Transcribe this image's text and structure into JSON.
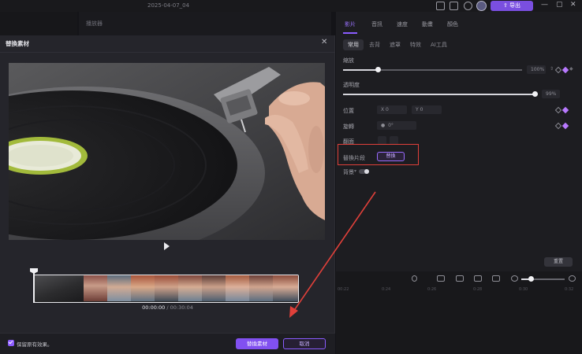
{
  "titlebar": {
    "date": "2025-04-07_04",
    "export_label": "导出"
  },
  "preview": {
    "header_label": "播放器"
  },
  "right_panel": {
    "tabs": [
      "影片",
      "音訊",
      "速度",
      "動畫",
      "顏色"
    ],
    "subtabs": [
      "常用",
      "去背",
      "遮罩",
      "特效",
      "AI工具"
    ],
    "scale_label": "縮放",
    "scale_value": "100%",
    "opacity_label": "透明度",
    "opacity_value": "99%",
    "position_label": "位置",
    "pos_x_label": "X",
    "pos_x_value": "0",
    "pos_y_label": "Y",
    "pos_y_value": "0",
    "rotate_label": "旋轉",
    "rotate_value": "0°",
    "flip_label": "翻面",
    "replace_clip_label": "替換片段",
    "replace_button": "替換",
    "background_label": "背景",
    "reset_button": "重置",
    "accent": "#8a5cff"
  },
  "timeline": {
    "ticks": [
      "00:22",
      "0:24",
      "0:26",
      "0:28",
      "0:30",
      "0:32"
    ]
  },
  "modal": {
    "title": "替換素材",
    "close_icon": "close-icon",
    "current_time": "00:00:00",
    "separator": " / ",
    "total_time": "00:30:04",
    "keep_effects_label": "保留原有效果。",
    "keep_effects_checked": true,
    "confirm_button": "替換素材",
    "cancel_button": "取消"
  },
  "annotation": {
    "color": "#e0403a"
  }
}
